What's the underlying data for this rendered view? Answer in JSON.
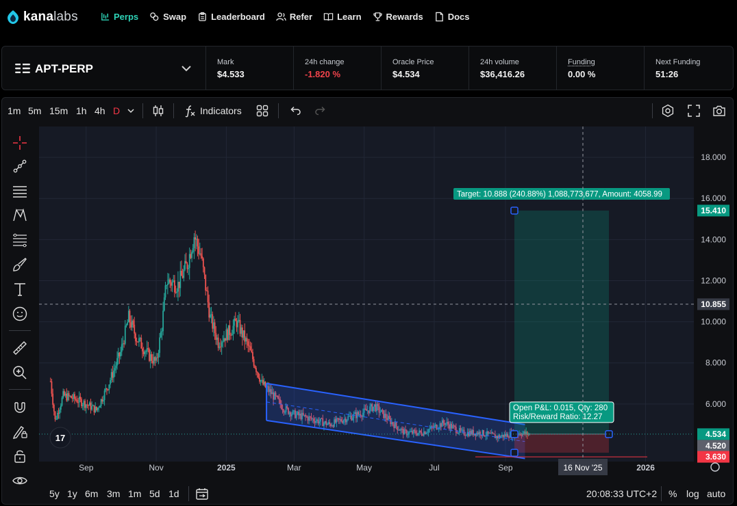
{
  "brand": {
    "name_bold": "kana",
    "name_light": "labs"
  },
  "nav": [
    {
      "label": "Perps",
      "icon": "perps-icon",
      "active": true
    },
    {
      "label": "Swap",
      "icon": "swap-icon"
    },
    {
      "label": "Leaderboard",
      "icon": "clipboard-icon"
    },
    {
      "label": "Refer",
      "icon": "users-icon"
    },
    {
      "label": "Learn",
      "icon": "book-icon"
    },
    {
      "label": "Rewards",
      "icon": "trophy-icon"
    },
    {
      "label": "Docs",
      "icon": "document-icon"
    }
  ],
  "market": {
    "pair": "APT-PERP",
    "stats": [
      {
        "label": "Mark",
        "value": "$4.533"
      },
      {
        "label": "24h change",
        "value": "-1.820 %",
        "negative": true
      },
      {
        "label": "Oracle Price",
        "value": "$4.534"
      },
      {
        "label": "24h volume",
        "value": "$36,416.26"
      },
      {
        "label": "Funding",
        "value": "0.00 %"
      },
      {
        "label": "Next Funding",
        "value": "51:26"
      }
    ]
  },
  "toolbar": {
    "timeframes": [
      "1m",
      "5m",
      "15m",
      "1h",
      "4h",
      "D"
    ],
    "selected_timeframe": "D",
    "indicators_label": "Indicators"
  },
  "bottombar": {
    "ranges": [
      "5y",
      "1y",
      "6m",
      "3m",
      "1m",
      "5d",
      "1d"
    ],
    "clock": "20:08:33 UTC+2",
    "percent": "%",
    "log": "log",
    "auto": "auto"
  },
  "colors": {
    "accent": "#2ed3b7",
    "up": "#26a69a",
    "down": "#ef5350",
    "channel": "#2962ff"
  },
  "chart_data": {
    "type": "candlestick",
    "symbol": "APT-PERP",
    "interval": "D",
    "y_ticks": [
      "18.000",
      "16.000",
      "14.000",
      "12.000",
      "10.000",
      "8.000",
      "6.000"
    ],
    "x_ticks": [
      "Sep",
      "Nov",
      "2025",
      "Mar",
      "May",
      "Jul",
      "Sep",
      "2026"
    ],
    "ylim": [
      3.2,
      19.5
    ],
    "price_path": [
      [
        "2024-08-01",
        7.1
      ],
      [
        "2024-08-05",
        5.2
      ],
      [
        "2024-08-12",
        6.4
      ],
      [
        "2024-08-20",
        6.3
      ],
      [
        "2024-09-01",
        6.0
      ],
      [
        "2024-09-10",
        5.7
      ],
      [
        "2024-09-20",
        6.9
      ],
      [
        "2024-10-01",
        8.5
      ],
      [
        "2024-10-08",
        10.2
      ],
      [
        "2024-10-15",
        9.2
      ],
      [
        "2024-10-25",
        8.4
      ],
      [
        "2024-11-01",
        8.0
      ],
      [
        "2024-11-06",
        9.8
      ],
      [
        "2024-11-10",
        12.0
      ],
      [
        "2024-11-20",
        11.8
      ],
      [
        "2024-11-28",
        12.8
      ],
      [
        "2024-12-04",
        14.2
      ],
      [
        "2024-12-10",
        13.2
      ],
      [
        "2024-12-18",
        10.2
      ],
      [
        "2024-12-25",
        9.0
      ],
      [
        "2025-01-05",
        9.6
      ],
      [
        "2025-01-10",
        10.0
      ],
      [
        "2025-01-20",
        8.8
      ],
      [
        "2025-02-01",
        7.0
      ],
      [
        "2025-02-08",
        6.6
      ],
      [
        "2025-02-20",
        5.8
      ],
      [
        "2025-03-01",
        5.5
      ],
      [
        "2025-03-15",
        5.3
      ],
      [
        "2025-04-01",
        5.0
      ],
      [
        "2025-04-15",
        5.3
      ],
      [
        "2025-05-01",
        5.6
      ],
      [
        "2025-05-10",
        5.9
      ],
      [
        "2025-05-25",
        5.1
      ],
      [
        "2025-06-05",
        4.6
      ],
      [
        "2025-06-20",
        4.6
      ],
      [
        "2025-07-10",
        5.1
      ],
      [
        "2025-07-25",
        4.6
      ],
      [
        "2025-08-10",
        4.6
      ],
      [
        "2025-08-25",
        4.4
      ],
      [
        "2025-09-12",
        4.6
      ],
      [
        "2025-09-22",
        4.53
      ]
    ],
    "drawings": {
      "channel": {
        "upper": [
          [
            "2025-02-05",
            7.0
          ],
          [
            "2025-09-18",
            5.0
          ]
        ],
        "lower": [
          [
            "2025-02-05",
            5.2
          ],
          [
            "2025-09-18",
            3.35
          ]
        ]
      },
      "long_position": {
        "entry": 4.534,
        "target": 15.41,
        "stop": 3.63,
        "target_label": "Target: 10.888 (240.88%) 1,088,773,677, Amount: 4058.99",
        "pnl_label": "Open P&L: 0.015, Qty: 280",
        "rr_label": "Risk/Reward Ratio: 12.27"
      }
    },
    "crosshair": {
      "price": "10.855",
      "date": "16 Nov '25"
    },
    "price_labels": [
      {
        "value": "15.410",
        "kind": "target"
      },
      {
        "value": "10.855",
        "kind": "crosshair"
      },
      {
        "value": "4.534",
        "kind": "last"
      },
      {
        "value": "4.520",
        "kind": "mark"
      },
      {
        "value": "3.630",
        "kind": "stop"
      }
    ]
  }
}
